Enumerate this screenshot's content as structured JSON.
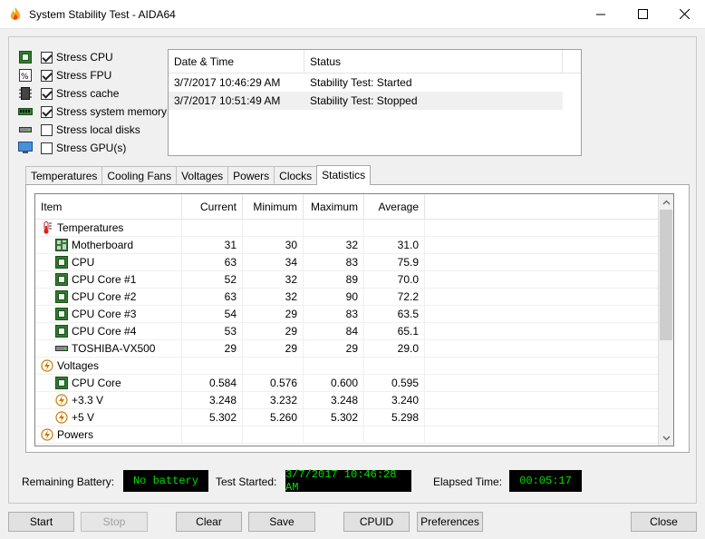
{
  "window": {
    "title": "System Stability Test - AIDA64"
  },
  "stress_options": [
    {
      "label": "Stress CPU",
      "checked": true,
      "icon": "cpu-icon"
    },
    {
      "label": "Stress FPU",
      "checked": true,
      "icon": "fpu-icon"
    },
    {
      "label": "Stress cache",
      "checked": true,
      "icon": "cache-icon"
    },
    {
      "label": "Stress system memory",
      "checked": true,
      "icon": "memory-icon"
    },
    {
      "label": "Stress local disks",
      "checked": false,
      "icon": "disk-icon"
    },
    {
      "label": "Stress GPU(s)",
      "checked": false,
      "icon": "gpu-icon"
    }
  ],
  "log": {
    "columns": [
      "Date & Time",
      "Status"
    ],
    "rows": [
      {
        "time": "3/7/2017 10:46:29 AM",
        "status": "Stability Test: Started"
      },
      {
        "time": "3/7/2017 10:51:49 AM",
        "status": "Stability Test: Stopped"
      }
    ]
  },
  "tabs": [
    "Temperatures",
    "Cooling Fans",
    "Voltages",
    "Powers",
    "Clocks",
    "Statistics"
  ],
  "active_tab": "Statistics",
  "stats": {
    "columns": [
      "Item",
      "Current",
      "Minimum",
      "Maximum",
      "Average"
    ],
    "groups": [
      {
        "name": "Temperatures",
        "icon": "thermometer-icon",
        "rows": [
          {
            "name": "Motherboard",
            "icon": "motherboard-icon",
            "cur": "31",
            "min": "30",
            "max": "32",
            "avg": "31.0"
          },
          {
            "name": "CPU",
            "icon": "cpu-icon",
            "cur": "63",
            "min": "34",
            "max": "83",
            "avg": "75.9"
          },
          {
            "name": "CPU Core #1",
            "icon": "cpu-icon",
            "cur": "52",
            "min": "32",
            "max": "89",
            "avg": "70.0"
          },
          {
            "name": "CPU Core #2",
            "icon": "cpu-icon",
            "cur": "63",
            "min": "32",
            "max": "90",
            "avg": "72.2"
          },
          {
            "name": "CPU Core #3",
            "icon": "cpu-icon",
            "cur": "54",
            "min": "29",
            "max": "83",
            "avg": "63.5"
          },
          {
            "name": "CPU Core #4",
            "icon": "cpu-icon",
            "cur": "53",
            "min": "29",
            "max": "84",
            "avg": "65.1"
          },
          {
            "name": "TOSHIBA-VX500",
            "icon": "disk-icon",
            "cur": "29",
            "min": "29",
            "max": "29",
            "avg": "29.0"
          }
        ]
      },
      {
        "name": "Voltages",
        "icon": "voltage-icon",
        "rows": [
          {
            "name": "CPU Core",
            "icon": "cpu-icon",
            "cur": "0.584",
            "min": "0.576",
            "max": "0.600",
            "avg": "0.595"
          },
          {
            "name": "+3.3 V",
            "icon": "voltage-icon",
            "cur": "3.248",
            "min": "3.232",
            "max": "3.248",
            "avg": "3.240"
          },
          {
            "name": "+5 V",
            "icon": "voltage-icon",
            "cur": "5.302",
            "min": "5.260",
            "max": "5.302",
            "avg": "5.298"
          }
        ]
      },
      {
        "name": "Powers",
        "icon": "voltage-icon",
        "rows": []
      }
    ]
  },
  "status": {
    "battery_label": "Remaining Battery:",
    "battery_value": "No battery",
    "started_label": "Test Started:",
    "started_value": "3/7/2017 10:46:28 AM",
    "elapsed_label": "Elapsed Time:",
    "elapsed_value": "00:05:17"
  },
  "buttons": {
    "start": "Start",
    "stop": "Stop",
    "clear": "Clear",
    "save": "Save",
    "cpuid": "CPUID",
    "preferences": "Preferences",
    "close": "Close"
  },
  "colors": {
    "lcd_bg": "#000000",
    "lcd_text": "#00e000",
    "accent_flame": "#f5a623"
  }
}
